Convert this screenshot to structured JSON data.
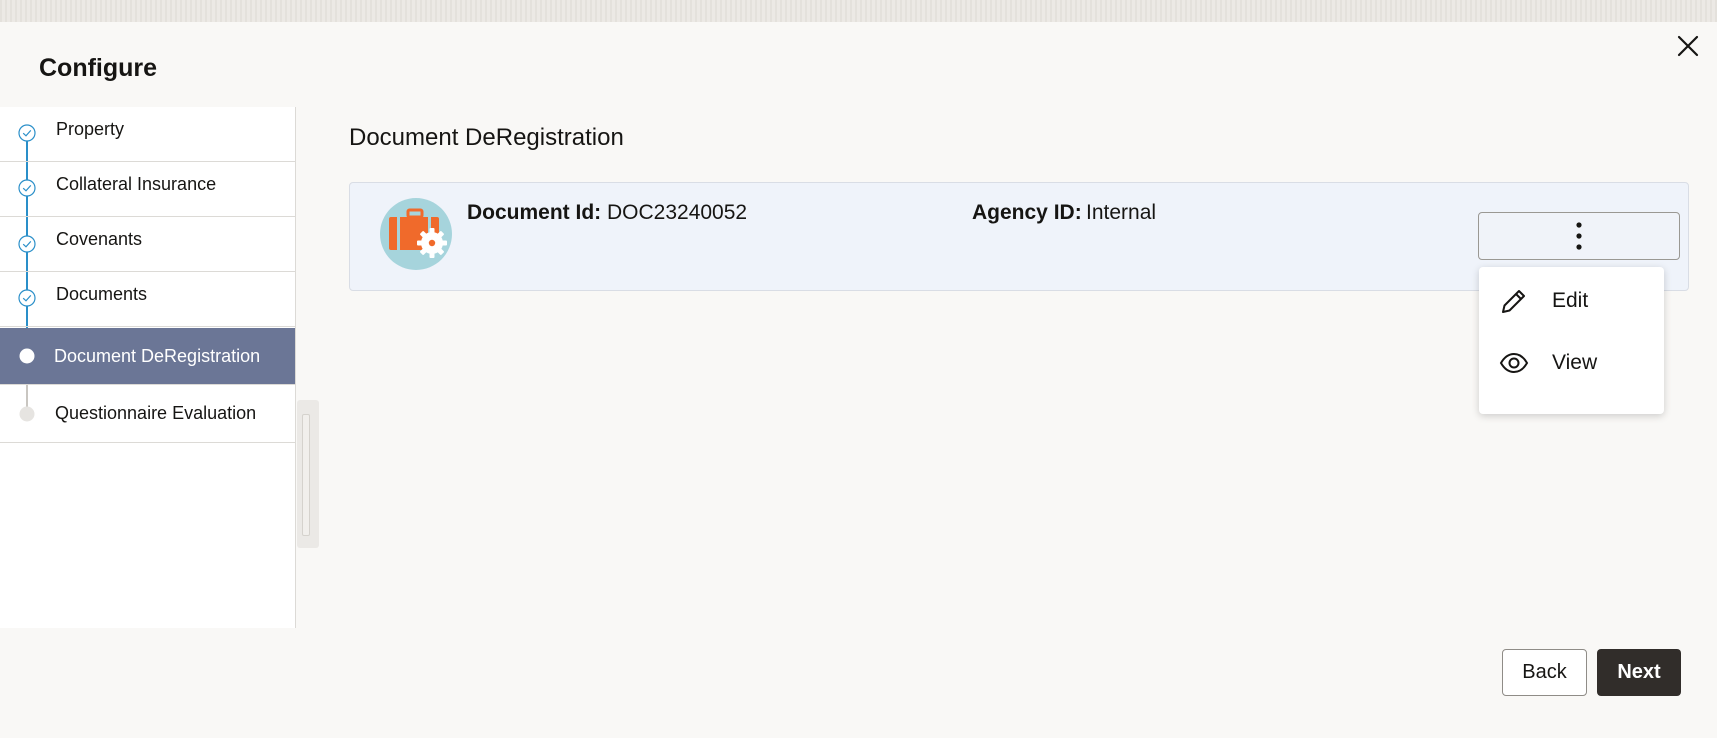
{
  "page": {
    "title": "Configure"
  },
  "sidebar": {
    "steps": [
      {
        "label": "Property",
        "status": "completed"
      },
      {
        "label": "Collateral Insurance",
        "status": "completed"
      },
      {
        "label": "Covenants",
        "status": "completed"
      },
      {
        "label": "Documents",
        "status": "completed"
      },
      {
        "label": "Document DeRegistration",
        "status": "active"
      },
      {
        "label": "Questionnaire Evaluation",
        "status": "pending"
      }
    ]
  },
  "main": {
    "section_title": "Document DeRegistration",
    "card": {
      "document_id_label": "Document Id:",
      "document_id_value": "DOC23240052",
      "agency_id_label": "Agency ID:",
      "agency_id_value": "Internal",
      "icon": "briefcase-gear-icon"
    },
    "actions_menu": {
      "icon": "kebab-vertical-icon",
      "items": [
        {
          "label": "Edit",
          "icon": "pencil-icon"
        },
        {
          "label": "View",
          "icon": "eye-icon"
        }
      ]
    }
  },
  "footer": {
    "back_label": "Back",
    "next_label": "Next"
  },
  "colors": {
    "active_step_bg": "#6b7696",
    "completed_track": "#2a8fc9",
    "card_bg": "#eff3fa",
    "primary_button": "#312d2a",
    "briefcase": "#f06a2b",
    "avatar_bg": "#a6d4dc"
  }
}
